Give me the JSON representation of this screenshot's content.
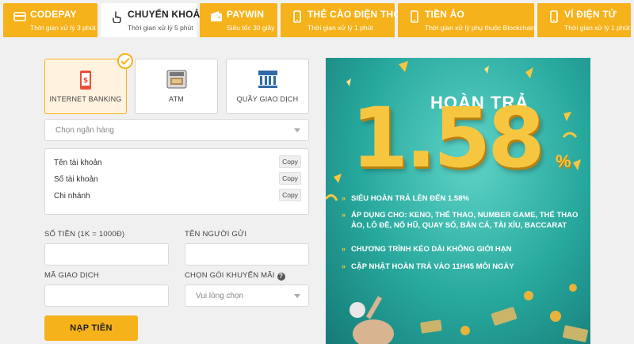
{
  "tabs": [
    {
      "name": "CODEPAY",
      "sub": "Thời gian xử lý 3 phút",
      "icon": "card-icon"
    },
    {
      "name": "CHUYỂN KHOẢN",
      "sub": "Thời gian xử lý 5 phút",
      "icon": "hand-tap-icon"
    },
    {
      "name": "PAYWIN",
      "sub": "Siêu tốc 30 giây",
      "icon": "wallet-icon"
    },
    {
      "name": "THẺ CÀO ĐIỆN THOẠI",
      "sub": "Thời gian xử lý 1 phút",
      "icon": "phone-icon"
    },
    {
      "name": "TIỀN ẢO",
      "sub": "Thời gian xử lý phụ thuộc Blockchain",
      "icon": "phone-icon"
    },
    {
      "name": "VÍ ĐIỆN TỬ",
      "sub": "Thời gian xử lý 1 phút",
      "icon": "phone-icon"
    }
  ],
  "methods": [
    {
      "label": "INTERNET BANKING",
      "icon": "mobile-banking-icon"
    },
    {
      "label": "ATM",
      "icon": "atm-icon"
    },
    {
      "label": "QUẦY GIAO DỊCH",
      "icon": "bank-icon"
    }
  ],
  "bank_select": {
    "placeholder": "Chọn ngân hàng"
  },
  "account_info": [
    {
      "label": "Tên tài khoản",
      "copy": "Copy"
    },
    {
      "label": "Số tài khoản",
      "copy": "Copy"
    },
    {
      "label": "Chi nhánh",
      "copy": "Copy"
    }
  ],
  "form": {
    "amount_label": "SỐ TIỀN (1K = 1000Đ)",
    "sender_label": "TÊN NGƯỜI GỬI",
    "txn_label": "MÃ GIAO DỊCH",
    "promo_label": "CHỌN GÓI KHUYẾN MÃI",
    "promo_placeholder": "Vui lòng chọn",
    "submit": "NẠP TIỀN"
  },
  "banner": {
    "heading": "HOÀN TRẢ",
    "big_number": "1.58",
    "percent": "%",
    "bullets": [
      "SIÊU HOÀN TRẢ LÊN ĐẾN 1.58%",
      "ÁP DỤNG CHO: KENO, THỂ THAO, NUMBER GAME, THỂ THAO ẢO, LÔ ĐỀ, NỔ HŨ, QUAY SỐ, BẮN CÁ, TÀI XỈU, BACCARAT",
      "CHƯƠNG TRÌNH KÉO DÀI KHÔNG GIỚI HẠN",
      "CẬP NHẬT HOÀN TRẢ VÀO 11H45 MỖI NGÀY"
    ]
  },
  "colors": {
    "accent": "#f6b21b",
    "banner": "#27a89d",
    "gold": "#f7c640"
  }
}
